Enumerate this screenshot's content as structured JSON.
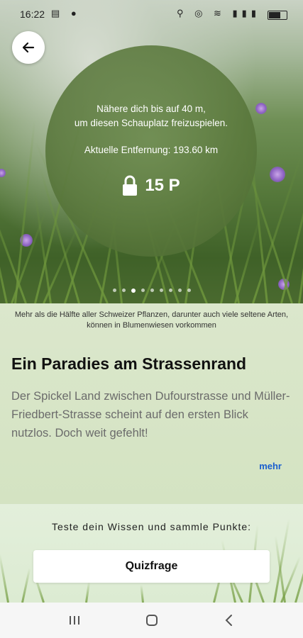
{
  "status_bar": {
    "time": "16:22",
    "left_icons": "▤ ●",
    "right_icons": "⚲ ◎ ≋ ▮▮▮"
  },
  "lock": {
    "hint_line1": "Nähere dich bis auf 40 m,",
    "hint_line2": "um diesen Schauplatz freizuspielen.",
    "distance": "Aktuelle Entfernung: 193.60 km",
    "points": "15 P"
  },
  "carousel": {
    "count": 9,
    "active_index": 2
  },
  "content": {
    "caption": "Mehr als die Hälfte aller Schweizer Pflanzen, darunter auch viele seltene Arten, können in Blumenwiesen vorkommen",
    "title": "Ein Paradies am Strassenrand",
    "description": "Der Spickel Land zwischen Dufourstrasse und Müller-Friedbert-Strasse scheint auf den ersten Blick nutzlos. Doch weit gefehlt!",
    "more_label": "mehr"
  },
  "quiz": {
    "prompt": "Teste dein Wissen und sammle Punkte:",
    "button_label": "Quizfrage"
  },
  "icons": {
    "back": "arrow-left-icon",
    "lock": "lock-icon",
    "recents": "recents-icon",
    "home": "home-icon",
    "nav_back": "chevron-left-icon"
  },
  "colors": {
    "link": "#1a5fcf",
    "content_bg": "#d4e3c2",
    "quiz_bg": "#e3efdb"
  }
}
